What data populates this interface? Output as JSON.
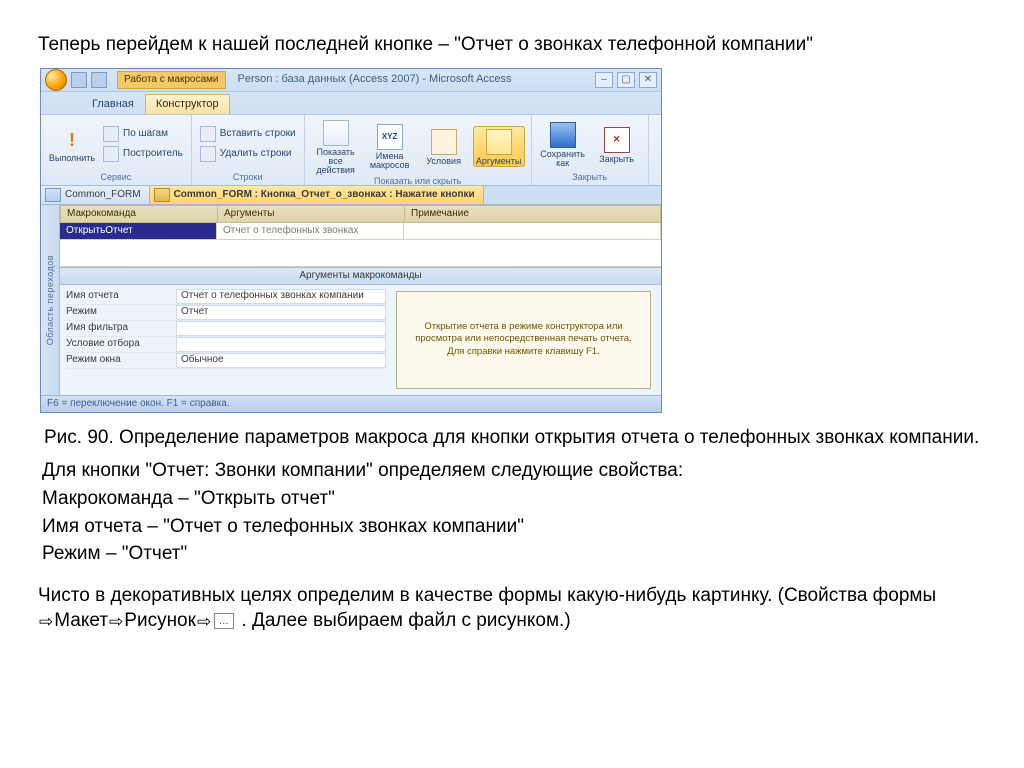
{
  "intro_text": "Теперь перейдем к нашей последней кнопке – \"Отчет о звонках телефонной компании\"",
  "access": {
    "context_badge": "Работа с макросами",
    "window_title": "Person : база данных (Access 2007) - Microsoft Access",
    "tabs": {
      "home": "Главная",
      "design": "Конструктор"
    },
    "ribbon": {
      "run": "Выполнить",
      "step": "По шагам",
      "builder": "Построитель",
      "insert_rows": "Вставить строки",
      "delete_rows": "Удалить строки",
      "show_all": "Показать все действия",
      "macro_names": "Имена макросов",
      "conditions": "Условия",
      "arguments": "Аргументы",
      "save_as": "Сохранить как",
      "close": "Закрыть",
      "grp_service": "Сервис",
      "grp_rows": "Строки",
      "grp_showhide": "Показать или скрыть",
      "grp_close": "Закрыть"
    },
    "doc_tabs": {
      "inactive": "Common_FORM",
      "active": "Common_FORM : Кнопка_Отчет_о_звонках : Нажатие кнопки"
    },
    "grid": {
      "col_action": "Макрокоманда",
      "col_args": "Аргументы",
      "col_comment": "Примечание",
      "cmd": "ОткрытьОтчет",
      "cmd_args": "Отчет о телефонных звонках"
    },
    "args_panel": {
      "title": "Аргументы макрокоманды",
      "rows": [
        {
          "lbl": "Имя отчета",
          "val": "Отчет о телефонных звонках компании"
        },
        {
          "lbl": "Режим",
          "val": "Отчет"
        },
        {
          "lbl": "Имя фильтра",
          "val": ""
        },
        {
          "lbl": "Условие отбора",
          "val": ""
        },
        {
          "lbl": "Режим окна",
          "val": "Обычное"
        }
      ],
      "help": "Открытие отчета в режиме конструктора или просмотра или непосредственная печать отчета. Для справки нажмите клавишу F1."
    },
    "nav_pane": "Область переходов",
    "statusbar": "F6 = переключение окон. F1 = справка."
  },
  "caption": "Рис. 90. Определение параметров макроса для кнопки открытия отчета о телефонных звонках компании.",
  "props": {
    "l1": "Для кнопки \"Отчет: Звонки компании\" определяем следующие свойства:",
    "l2": "Макрокоманда – \"Открыть отчет\"",
    "l3": "Имя отчета – \"Отчет о телефонных звонках компании\"",
    "l4": "Режим – \"Отчет\""
  },
  "decor": {
    "p1a": "Чисто в декоративных целях определим в качестве формы какую-нибудь картинку. (Свойства формы ",
    "p1b": "Макет",
    "p1c": "Рисунок",
    "p1d": " . Далее выбираем файл с рисунком.)"
  }
}
